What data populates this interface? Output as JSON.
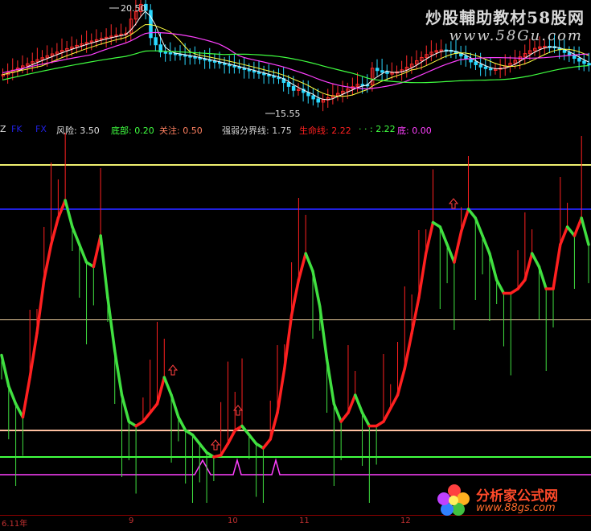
{
  "watermark": {
    "title": "炒股輔助教材58股网",
    "url": "www.58Gu.com"
  },
  "price_labels": {
    "high": "20.50",
    "low": "15.55"
  },
  "legend": [
    {
      "key": "z",
      "text": "Z",
      "color": "#e0e0e0"
    },
    {
      "key": "fk1",
      "text": "FK",
      "color": "#2020e0"
    },
    {
      "key": "fk2",
      "text": "FX",
      "color": "#2020e0"
    },
    {
      "key": "risk",
      "text": "风险: 3.50",
      "color": "#e0e0e0"
    },
    {
      "key": "bottom",
      "text": "底部: 0.20",
      "color": "#40ff40"
    },
    {
      "key": "focus",
      "text": "关注: 0.50",
      "color": "#ff8060"
    },
    {
      "key": "divider",
      "text": "强弱分界线: 1.75",
      "color": "#d0d0d0"
    },
    {
      "key": "life",
      "text": "生命线: 2.22",
      "color": "#ff2020"
    },
    {
      "key": "dash",
      "text": "· · : 2.22",
      "color": "#40ff40"
    },
    {
      "key": "bottom2",
      "text": "底: 0.00",
      "color": "#ff40ff"
    }
  ],
  "axis_labels": [
    "6.11年",
    "9",
    "10",
    "11",
    "12"
  ],
  "logo": {
    "name": "分析家公式网",
    "url": "www.88gs.com"
  },
  "colors": {
    "up": "#ff2a2a",
    "down": "#2ad8ff",
    "ma1": "#ffffff",
    "ma2": "#ffff40",
    "ma3": "#ff40ff",
    "ma4": "#40ff40",
    "red_line": "#ff2020",
    "green_line": "#40e040",
    "risk_line": "#f0f070",
    "blue_line": "#2020e0",
    "mid_line": "#f0d0a0",
    "focus_line": "#ffc0a0",
    "bottom_line": "#40ff40",
    "purple_line": "#ff40ff"
  },
  "chart_data": {
    "type": "line",
    "levels": {
      "risk": 3.5,
      "upper_blue": 3.0,
      "divider": 1.75,
      "focus": 0.5,
      "bottom": 0.2,
      "bottom2": 0.0
    },
    "price": {
      "high": 20.5,
      "low": 15.55
    },
    "indicator": [
      1.35,
      1.0,
      0.8,
      0.65,
      1.1,
      1.6,
      2.2,
      2.6,
      2.9,
      3.1,
      2.8,
      2.6,
      2.4,
      2.35,
      2.7,
      2.0,
      1.4,
      0.9,
      0.6,
      0.55,
      0.6,
      0.7,
      0.8,
      1.1,
      0.9,
      0.65,
      0.5,
      0.45,
      0.35,
      0.25,
      0.2,
      0.22,
      0.35,
      0.5,
      0.55,
      0.45,
      0.35,
      0.3,
      0.4,
      0.7,
      1.2,
      1.8,
      2.2,
      2.5,
      2.3,
      1.9,
      1.3,
      0.8,
      0.6,
      0.7,
      0.9,
      0.7,
      0.55,
      0.55,
      0.6,
      0.75,
      0.9,
      1.2,
      1.6,
      2.0,
      2.5,
      2.85,
      2.8,
      2.6,
      2.4,
      2.75,
      3.0,
      2.9,
      2.7,
      2.5,
      2.2,
      2.05,
      2.05,
      2.1,
      2.2,
      2.5,
      2.35,
      2.1,
      2.1,
      2.6,
      2.8,
      2.7,
      2.9,
      2.6
    ]
  }
}
